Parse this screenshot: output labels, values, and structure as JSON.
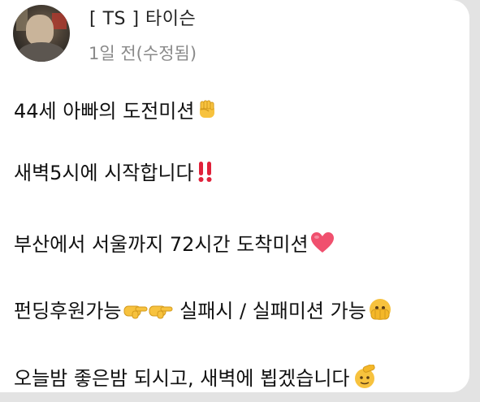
{
  "post": {
    "author": "[ TS ] 타이슨",
    "time": "1일 전(수정됨)",
    "lines": [
      {
        "text": "44세 아빠의 도전미션",
        "emoji": "raised-fist-icon"
      },
      {
        "text": "새벽5시에 시작합니다",
        "emoji": "double-exclamation-icon"
      },
      {
        "text": "부산에서 서울까지 72시간 도착미션",
        "emoji": "red-heart-icon"
      },
      {
        "text": "펀딩후원가능",
        "emoji": "pointing-hands-icon",
        "after": " 실패시 / 실패미션 가능",
        "emoji2": "face-peeking-icon"
      },
      {
        "text": "오늘밤 좋은밤 되시고, 새벽에 뵙겠습니다",
        "emoji": "saluting-face-icon"
      }
    ]
  },
  "colors": {
    "heart": "#f0506e",
    "exclamation": "#e0213a",
    "emoji_yellow": "#f7c23e"
  }
}
